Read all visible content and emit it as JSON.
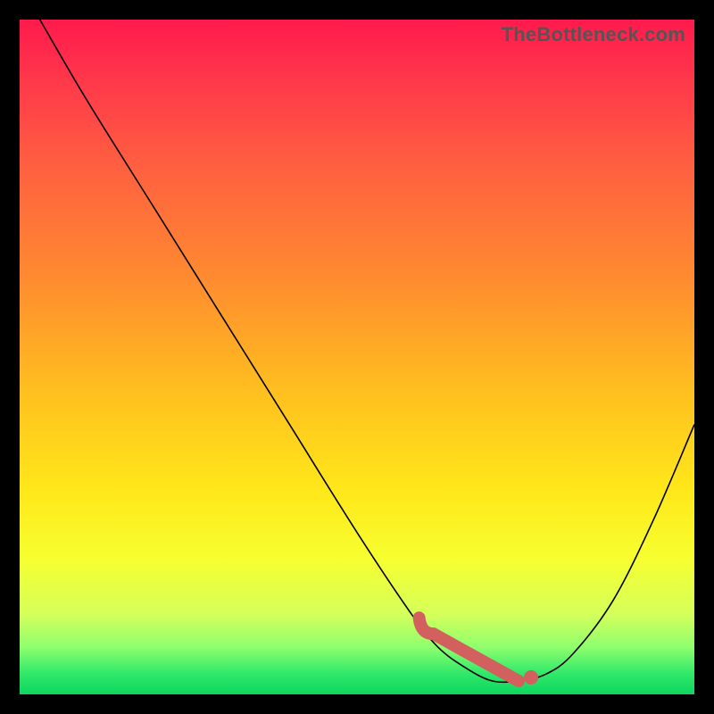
{
  "watermark": "TheBottleneck.com",
  "chart_data": {
    "type": "line",
    "title": "",
    "xlabel": "",
    "ylabel": "",
    "xlim": [
      0,
      100
    ],
    "ylim": [
      0,
      100
    ],
    "grid": false,
    "series": [
      {
        "name": "curve",
        "x": [
          3,
          10,
          20,
          30,
          40,
          50,
          58,
          62,
          66,
          70,
          74,
          78,
          82,
          88,
          94,
          100
        ],
        "y": [
          100,
          88,
          72,
          56,
          40,
          24,
          12,
          7,
          4,
          2,
          2,
          3,
          6,
          14,
          26,
          40
        ]
      }
    ],
    "highlight_range_x": [
      60,
      75
    ],
    "highlight_point_x": 75,
    "colors": {
      "curve": "#000000",
      "highlight": "#d1605e"
    }
  }
}
